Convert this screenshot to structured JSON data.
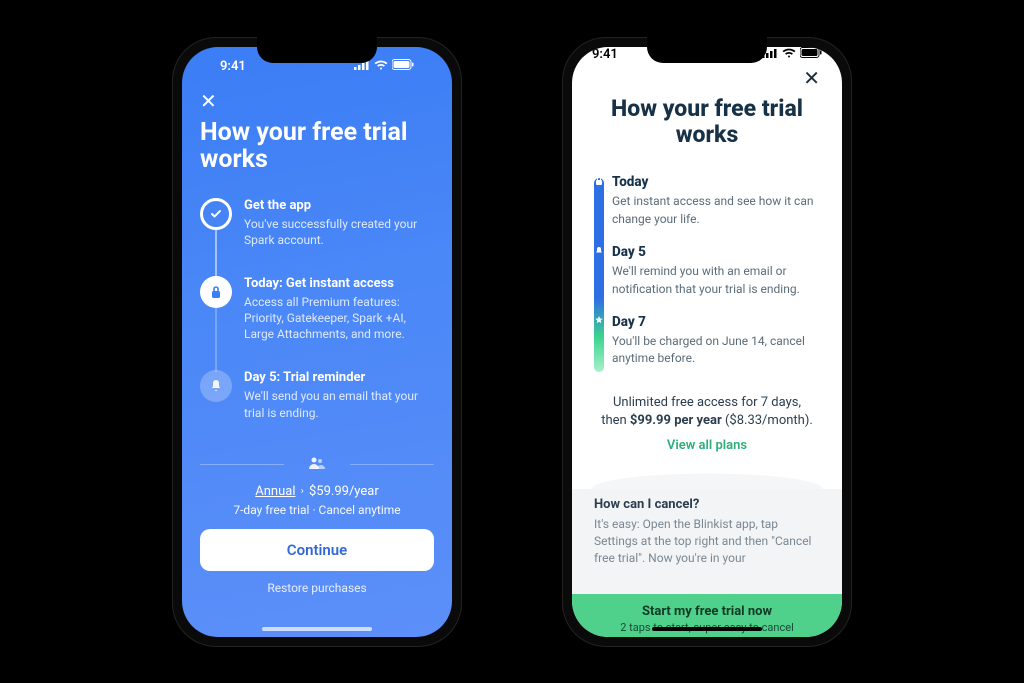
{
  "statusbar": {
    "time": "9:41"
  },
  "phoneA": {
    "title": "How your free trial works",
    "steps": [
      {
        "title": "Get the app",
        "desc": "You've successfully created your Spark account."
      },
      {
        "title": "Today: Get instant access",
        "desc": "Access all Premium features: Priority, Gatekeeper, Spark +AI, Large Attachments, and more."
      },
      {
        "title": "Day 5: Trial reminder",
        "desc": "We'll send you an email that your trial is ending."
      }
    ],
    "plan_label": "Annual",
    "plan_price": "$59.99/year",
    "sub_line": "7-day free trial · Cancel anytime",
    "cta": "Continue",
    "restore": "Restore purchases"
  },
  "phoneB": {
    "title": "How your free trial works",
    "steps": [
      {
        "title": "Today",
        "desc": "Get instant access and see how it can change your life."
      },
      {
        "title": "Day 5",
        "desc": "We'll remind you with an email or notification that your trial is ending."
      },
      {
        "title": "Day 7",
        "desc": "You'll be charged on June 14, cancel anytime before."
      }
    ],
    "pricing_line1": "Unlimited free access for 7 days,",
    "pricing_bold": "$99.99 per year",
    "pricing_tail": " ($8.33/month).",
    "pricing_prefix": "then ",
    "view_plans": "View all plans",
    "faq_title": "How can I cancel?",
    "faq_text": "It's easy: Open the Blinkist app, tap Settings at the top right and then \"Cancel free trial\". Now you're in your",
    "cta_line1": "Start my free trial now",
    "cta_line2": "2 taps to start, super easy to cancel"
  }
}
